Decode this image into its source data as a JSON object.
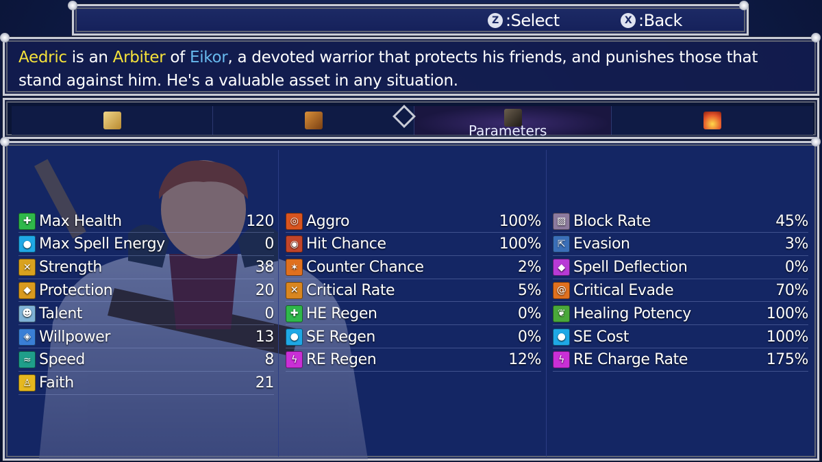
{
  "hints": [
    {
      "glyph": "Z",
      "label": ":Select"
    },
    {
      "glyph": "X",
      "label": ":Back"
    }
  ],
  "description": {
    "name": "Aedric",
    "part1": " is an ",
    "class": "Arbiter",
    "part2": " of ",
    "deity": "Eikor",
    "part3": ", a devoted warrior that protects his friends, and punishes those that stand against him. He's a valuable asset in any situation."
  },
  "tabs": [
    {
      "icon": "scroll-icon",
      "color": "#d9b45a"
    },
    {
      "icon": "book-icon",
      "color": "#b8742a"
    },
    {
      "icon": "crystal-icon",
      "color": "#3a342c",
      "label": "Parameters",
      "active": true
    },
    {
      "icon": "fire-icon",
      "color": "#e2542a"
    }
  ],
  "stats_col1": [
    {
      "label": "Max Health",
      "value": "120",
      "icon": "plus-icon",
      "color": "#2fb84a"
    },
    {
      "label": "Max Spell Energy",
      "value": "0",
      "icon": "orb-icon",
      "color": "#1fa8e6"
    },
    {
      "label": "Strength",
      "value": "38",
      "icon": "swords-icon",
      "color": "#d9a21f"
    },
    {
      "label": "Protection",
      "value": "20",
      "icon": "shield-icon",
      "color": "#d99a1f"
    },
    {
      "label": "Talent",
      "value": "0",
      "icon": "head-icon",
      "color": "#7fb2d6"
    },
    {
      "label": "Willpower",
      "value": "13",
      "icon": "crest-icon",
      "color": "#3a7fd6"
    },
    {
      "label": "Speed",
      "value": "8",
      "icon": "wind-icon",
      "color": "#1f9e8a"
    },
    {
      "label": "Faith",
      "value": "21",
      "icon": "meditate-icon",
      "color": "#e6b81f"
    }
  ],
  "stats_col2": [
    {
      "label": "Aggro",
      "value": "100%",
      "icon": "target-icon",
      "color": "#d9541f"
    },
    {
      "label": "Hit Chance",
      "value": "100%",
      "icon": "bullseye-icon",
      "color": "#c2452a"
    },
    {
      "label": "Counter Chance",
      "value": "2%",
      "icon": "burst-icon",
      "color": "#e0701f"
    },
    {
      "label": "Critical Rate",
      "value": "5%",
      "icon": "crit-swords-icon",
      "color": "#d9861f"
    },
    {
      "label": "HE Regen",
      "value": "0%",
      "icon": "plus-icon",
      "color": "#2fb84a"
    },
    {
      "label": "SE Regen",
      "value": "0%",
      "icon": "orb-icon",
      "color": "#1fa8e6"
    },
    {
      "label": "RE Regen",
      "value": "12%",
      "icon": "bolt-icon",
      "color": "#c92fd6"
    }
  ],
  "stats_col3": [
    {
      "label": "Block Rate",
      "value": "45%",
      "icon": "block-icon",
      "color": "#8c7a9e"
    },
    {
      "label": "Evasion",
      "value": "3%",
      "icon": "dash-icon",
      "color": "#3a6fb8"
    },
    {
      "label": "Spell Deflection",
      "value": "0%",
      "icon": "gem-icon",
      "color": "#b83ad6"
    },
    {
      "label": "Critical Evade",
      "value": "70%",
      "icon": "spiral-icon",
      "color": "#e0701f"
    },
    {
      "label": "Healing Potency",
      "value": "100%",
      "icon": "leaf-icon",
      "color": "#4aa83a"
    },
    {
      "label": "SE Cost",
      "value": "100%",
      "icon": "orb-icon",
      "color": "#1fa8e6"
    },
    {
      "label": "RE Charge Rate",
      "value": "175%",
      "icon": "bolt-icon",
      "color": "#c92fd6"
    }
  ]
}
